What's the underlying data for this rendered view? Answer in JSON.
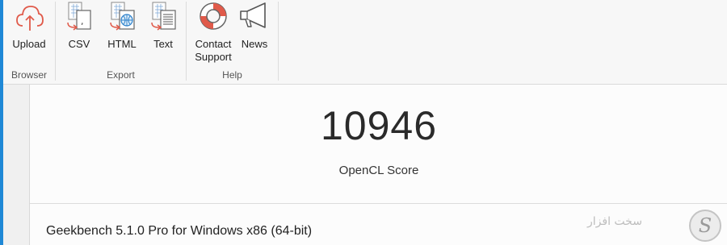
{
  "ribbon": {
    "groups": [
      {
        "label": "Browser",
        "buttons": [
          {
            "label": "Upload",
            "icon": "cloud-upload-icon"
          }
        ]
      },
      {
        "label": "Export",
        "buttons": [
          {
            "label": "CSV",
            "icon": "csv-file-icon"
          },
          {
            "label": "HTML",
            "icon": "html-file-icon"
          },
          {
            "label": "Text",
            "icon": "text-file-icon"
          }
        ]
      },
      {
        "label": "Help",
        "buttons": [
          {
            "label": "Contact Support",
            "icon": "lifebuoy-icon"
          },
          {
            "label": "News",
            "icon": "megaphone-icon"
          }
        ]
      }
    ]
  },
  "result": {
    "score": "10946",
    "score_label": "OpenCL Score",
    "version": "Geekbench 5.1.0 Pro for Windows x86 (64-bit)"
  },
  "watermark": {
    "text": "سخت افزار",
    "logo": "s-logo-icon"
  },
  "colors": {
    "accent": "#1f88d6",
    "icon_red": "#e05a4a",
    "icon_blue": "#2a7fc9"
  }
}
